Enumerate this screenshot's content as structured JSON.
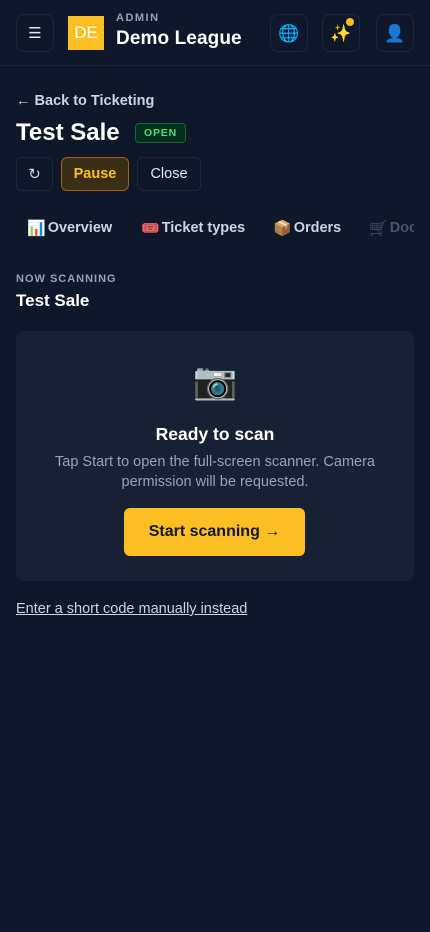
{
  "header": {
    "menu_icon": "☰",
    "logo_text": "DE",
    "kicker": "ADMIN",
    "league_name": "Demo League",
    "globe_icon": "🌐",
    "sparkles_icon": "✨",
    "user_icon": "👤",
    "accent_color": "#fbbf24"
  },
  "page": {
    "back_link": "← Back to Ticketing",
    "title": "Test Sale",
    "status_badge": "OPEN"
  },
  "actions": {
    "refresh_icon": "↻",
    "pause_label": "Pause",
    "close_label": "Close"
  },
  "tabs": [
    {
      "emoji": "📊",
      "label": "Overview"
    },
    {
      "emoji": "🎟️",
      "label": "Ticket types"
    },
    {
      "emoji": "📦",
      "label": "Orders"
    },
    {
      "emoji": "🛒",
      "label": "Doo"
    }
  ],
  "scanner": {
    "kicker": "NOW SCANNING",
    "event_name": "Test Sale",
    "camera_icon": "📷",
    "title": "Ready to scan",
    "description": "Tap Start to open the full-screen scanner. Camera permission will be requested.",
    "start_label": "Start scanning →",
    "manual_link": "Enter a short code manually instead"
  }
}
